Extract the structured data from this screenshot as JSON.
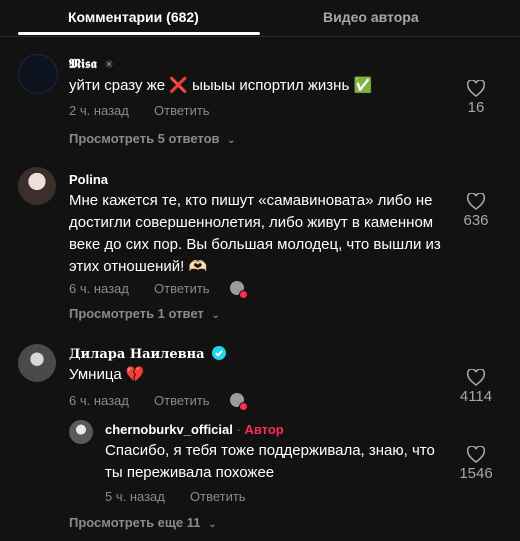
{
  "tabs": {
    "comments": "Комментарии (682)",
    "author_videos": "Видео автора"
  },
  "comments": [
    {
      "author": "𝕸𝖎𝖘𝖆",
      "text": "уйти сразу же ❌ ыыыы испортил жизнь ✅",
      "time": "2 ч. назад",
      "reply_label": "Ответить",
      "likes": "16",
      "view_replies": "Просмотреть 5 ответов"
    },
    {
      "author": "Polina",
      "text": "Мне кажется те, кто пишут «самавиноватa» либо не достигли совершеннолетия, либо живут в каменном веке до сих пор. Вы большая молодец, что вышли из этих отношений! 🫶🏻",
      "time": "6 ч. назад",
      "reply_label": "Ответить",
      "likes": "636",
      "view_replies": "Просмотреть 1 ответ"
    },
    {
      "author": "Дилара Наилевна",
      "text": "Умница 💔",
      "time": "6 ч. назад",
      "reply_label": "Ответить",
      "likes": "4114",
      "view_replies": "Просмотреть еще 11"
    }
  ],
  "reply": {
    "author": "chernoburkv_official",
    "separator": " · ",
    "author_badge": "Автор",
    "text": "Спасибо, я тебя тоже поддерживала, знаю, что ты переживала похожее",
    "time": "5 ч. назад",
    "reply_label": "Ответить",
    "likes": "1546"
  },
  "colors": {
    "background": "#121212",
    "accent": "#fe2c55",
    "verified": "#20d5ec",
    "muted": "#8a8a8a"
  }
}
